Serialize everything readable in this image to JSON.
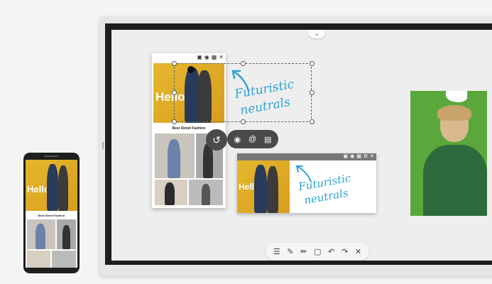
{
  "document": {
    "hero_text": "Hello",
    "caption": "Best Street Fashion",
    "toolbar_icons": [
      "save-icon",
      "share-icon",
      "export-icon",
      "close-icon"
    ]
  },
  "annotation": {
    "line1": "Futuristic",
    "line2": "neutrals"
  },
  "panel2": {
    "hero_text": "Hello",
    "annotation_line1": "Futuristic",
    "annotation_line2": "neutrals",
    "toolbar_icons": [
      "save-icon",
      "share-icon",
      "export-icon",
      "settings-icon",
      "close-icon"
    ]
  },
  "phone": {
    "hero_text": "Hello",
    "caption": "Best Street Fashion"
  },
  "context_menu": {
    "icons": [
      "history-icon",
      "camera-icon",
      "at-icon",
      "document-icon"
    ]
  },
  "bottom_toolbar": {
    "icons": [
      "menu-icon",
      "pen-icon",
      "highlighter-icon",
      "select-icon",
      "undo-icon",
      "redo-icon",
      "close-icon"
    ]
  },
  "colors": {
    "accent_handwriting": "#2fa4cf",
    "hero_yellow": "#e5b72c",
    "portrait_green": "#5aa83b",
    "menu_dark": "#4a4a4a"
  }
}
